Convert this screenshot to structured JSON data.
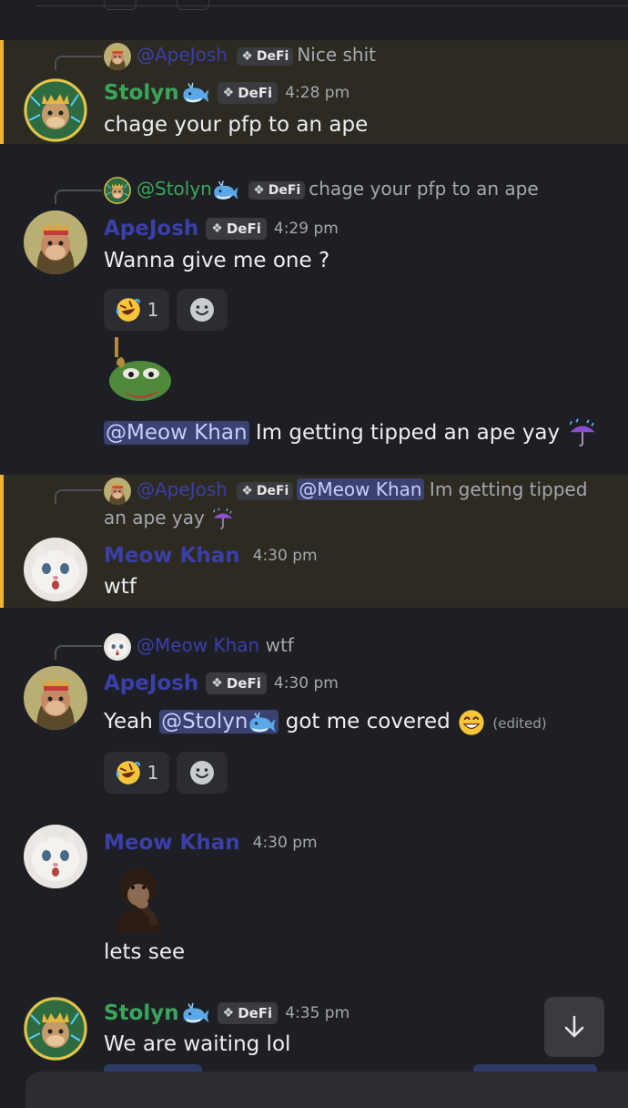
{
  "colors": {
    "background": "#1e1f24",
    "highlight_bg": "#2d2a22",
    "highlight_bar": "#f0b232",
    "stolyn_name": "#3ba55c",
    "apejosh_name": "#3b3fa8",
    "meowkhan_name": "#3b3fa8",
    "mention_bg": "#3c4270"
  },
  "tag_label": "DeFi",
  "icons": {
    "whale": "whale-emoji",
    "rofl": "rofl-emoji",
    "umbrella": "umbrella-rain-emoji",
    "grin": "grinning-emoji",
    "add_reaction": "smile-add-reaction-icon",
    "scroll_down": "arrow-down-icon"
  },
  "messages": [
    {
      "reply_to": {
        "name": "@ApeJosh",
        "text": "Nice shit"
      },
      "author": "Stolyn",
      "time": "4:28 pm",
      "text": "chage your pfp to an ape"
    },
    {
      "reply_to": {
        "name": "@Stolyn",
        "text": "chage your pfp to an ape"
      },
      "author": "ApeJosh",
      "time": "4:29 pm",
      "text": "Wanna give me one ?",
      "reaction_count": "1",
      "sticker": "pepe-hanging-sticker",
      "followup_mention": "@Meow Khan",
      "followup_text": "Im getting tipped an ape yay"
    },
    {
      "reply_to": {
        "name": "@ApeJosh",
        "mention": "@Meow Khan",
        "text": "Im getting tipped",
        "text2": "an ape yay"
      },
      "author": "Meow Khan",
      "time": "4:30 pm",
      "text": "wtf"
    },
    {
      "reply_to": {
        "name": "@Meow Khan",
        "text": "wtf"
      },
      "author": "ApeJosh",
      "time": "4:30 pm",
      "text_before": "Yeah",
      "mention": "@Stolyn",
      "text_after": "got me covered",
      "edited": "(edited)",
      "reaction_count": "1"
    },
    {
      "author": "Meow Khan",
      "time": "4:30 pm",
      "sticker": "thinking-chimp-sticker",
      "text": "lets see"
    },
    {
      "author": "Stolyn",
      "time": "4:35 pm",
      "text": "We are waiting lol"
    }
  ]
}
